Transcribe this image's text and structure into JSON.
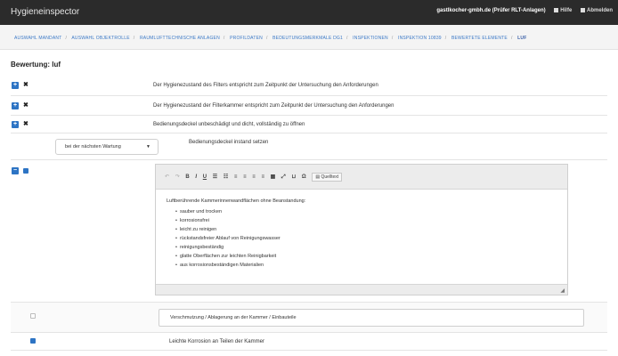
{
  "app": {
    "brand": "Hygieneinspector",
    "company": "gastlkocher-gmbh.de (Prüfer RLT-Anlagen)",
    "help": "Hilfe",
    "logout": "Abmelden"
  },
  "breadcrumbs": [
    "AUSWAHL MANDANT",
    "AUSWAHL OBJEKTROLLE",
    "RAUMLUFTTECHNISCHE ANLAGEN",
    "PROFILDATEN",
    "BEDEUTUNGSMERKMALE DG1",
    "INSPEKTIONEN",
    "INSPEKTION 10839",
    "BEWERTETE ELEMENTE",
    "LUF"
  ],
  "section_title": "Bewertung: luf",
  "rows": [
    {
      "text": "Der Hygienezustand des Filters entspricht zum Zeitpunkt der Untersuchung den Anforderungen"
    },
    {
      "text": "Der Hygienezustand der Filterkammer entspricht zum Zeitpunkt der Untersuchung den Anforderungen"
    },
    {
      "text": "Bedienungsdeckel unbeschädigt und dicht, vollständig zu öffnen"
    }
  ],
  "measure": {
    "select_value": "bei der nächsten Wartung",
    "text": "Bedienungsdeckel instand setzen"
  },
  "editor": {
    "source_label": "Quelltext",
    "intro": "Luftberührende Kammerinnenwandflächen ohne Beanstandung:",
    "items": [
      "sauber und trocken",
      "korrosionsfrei",
      "leicht zu reinigen",
      "rückstandsfreier Ablauf von Reinigungswasser",
      "reinigungsbeständig",
      "glatte Oberflächen zur leichten Reinigbarkeit",
      "aus korrosionsbeständigen Materialien"
    ]
  },
  "input_row": {
    "value": "Verschmutzung / Ablagerung an der Kammer / Einbauteile"
  },
  "last_row": {
    "text": "Leichte Korrosion an Teilen der Kammer"
  },
  "colors": {
    "accent": "#2d74c4",
    "topbar": "#2b2b2b"
  },
  "icons": [
    "plus-icon",
    "x-icon",
    "checkbox-icon",
    "resize-grip-icon"
  ]
}
